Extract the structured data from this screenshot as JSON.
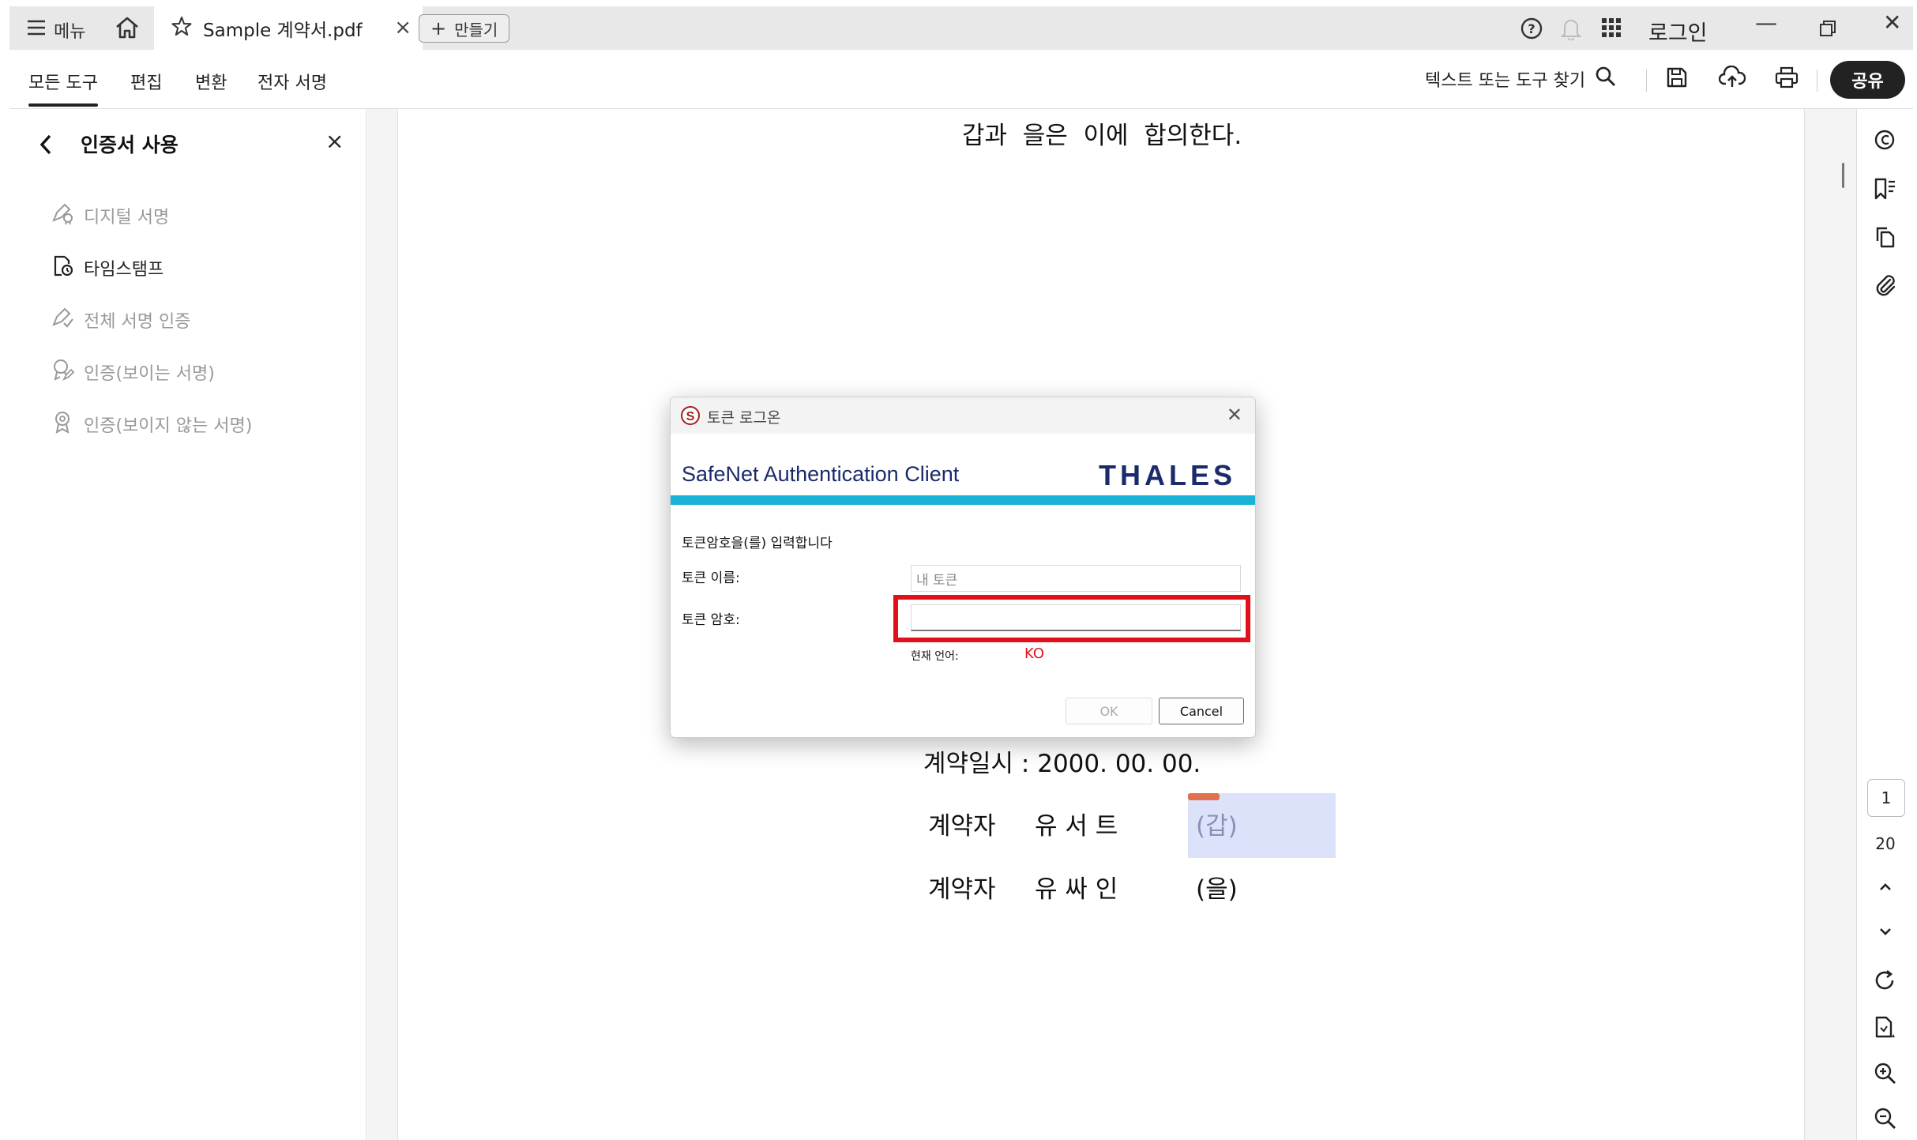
{
  "tabbar": {
    "menu_label": "메뉴",
    "doc_tab_title": "Sample 계약서.pdf",
    "create_label": "만들기",
    "login_label": "로그인"
  },
  "toolbar": {
    "tabs": [
      "모든 도구",
      "편집",
      "변환",
      "전자 서명"
    ],
    "active_tab": "모든 도구",
    "search_label": "텍스트 또는 도구 찾기",
    "share_label": "공유"
  },
  "left_panel": {
    "title": "인증서 사용",
    "items": [
      {
        "label": "디지털 서명",
        "icon": "digital-sign-icon",
        "enabled": false
      },
      {
        "label": "타임스탬프",
        "icon": "timestamp-icon",
        "enabled": true
      },
      {
        "label": "전체 서명 인증",
        "icon": "certify-all-icon",
        "enabled": false
      },
      {
        "label": "인증(보이는 서명)",
        "icon": "certify-visible-icon",
        "enabled": false
      },
      {
        "label": "인증(보이지 않는 서명)",
        "icon": "certify-invisible-icon",
        "enabled": false
      }
    ]
  },
  "document": {
    "line_top": "갑과  을은  이에  합의한다.",
    "contract_date": "계약일시 : 2000. 00. 00.",
    "party1_label": "계약자",
    "party1_name": "유 서 트",
    "party1_role": "(갑)",
    "party2_label": "계약자",
    "party2_name": "유 싸 인",
    "party2_role": "(을)"
  },
  "right_rail": {
    "current_page": "1",
    "total_pages": "20"
  },
  "dialog": {
    "title": "토큰 로그온",
    "brand": "SafeNet Authentication Client",
    "vendor": "THALES",
    "prompt": "토큰암호을(를) 입력합니다",
    "token_name_label": "토큰 이름:",
    "token_name_value": "내 토큰",
    "token_password_label": "토큰 암호:",
    "token_password_value": "",
    "current_language_label": "현재 언어:",
    "current_language_value": "KO",
    "ok_label": "OK",
    "cancel_label": "Cancel"
  },
  "colors": {
    "brand_navy": "#1b2a6b",
    "stripe_cyan": "#18b3d6",
    "highlight_red": "#e3101a",
    "signature_field": "#dde2fb"
  }
}
